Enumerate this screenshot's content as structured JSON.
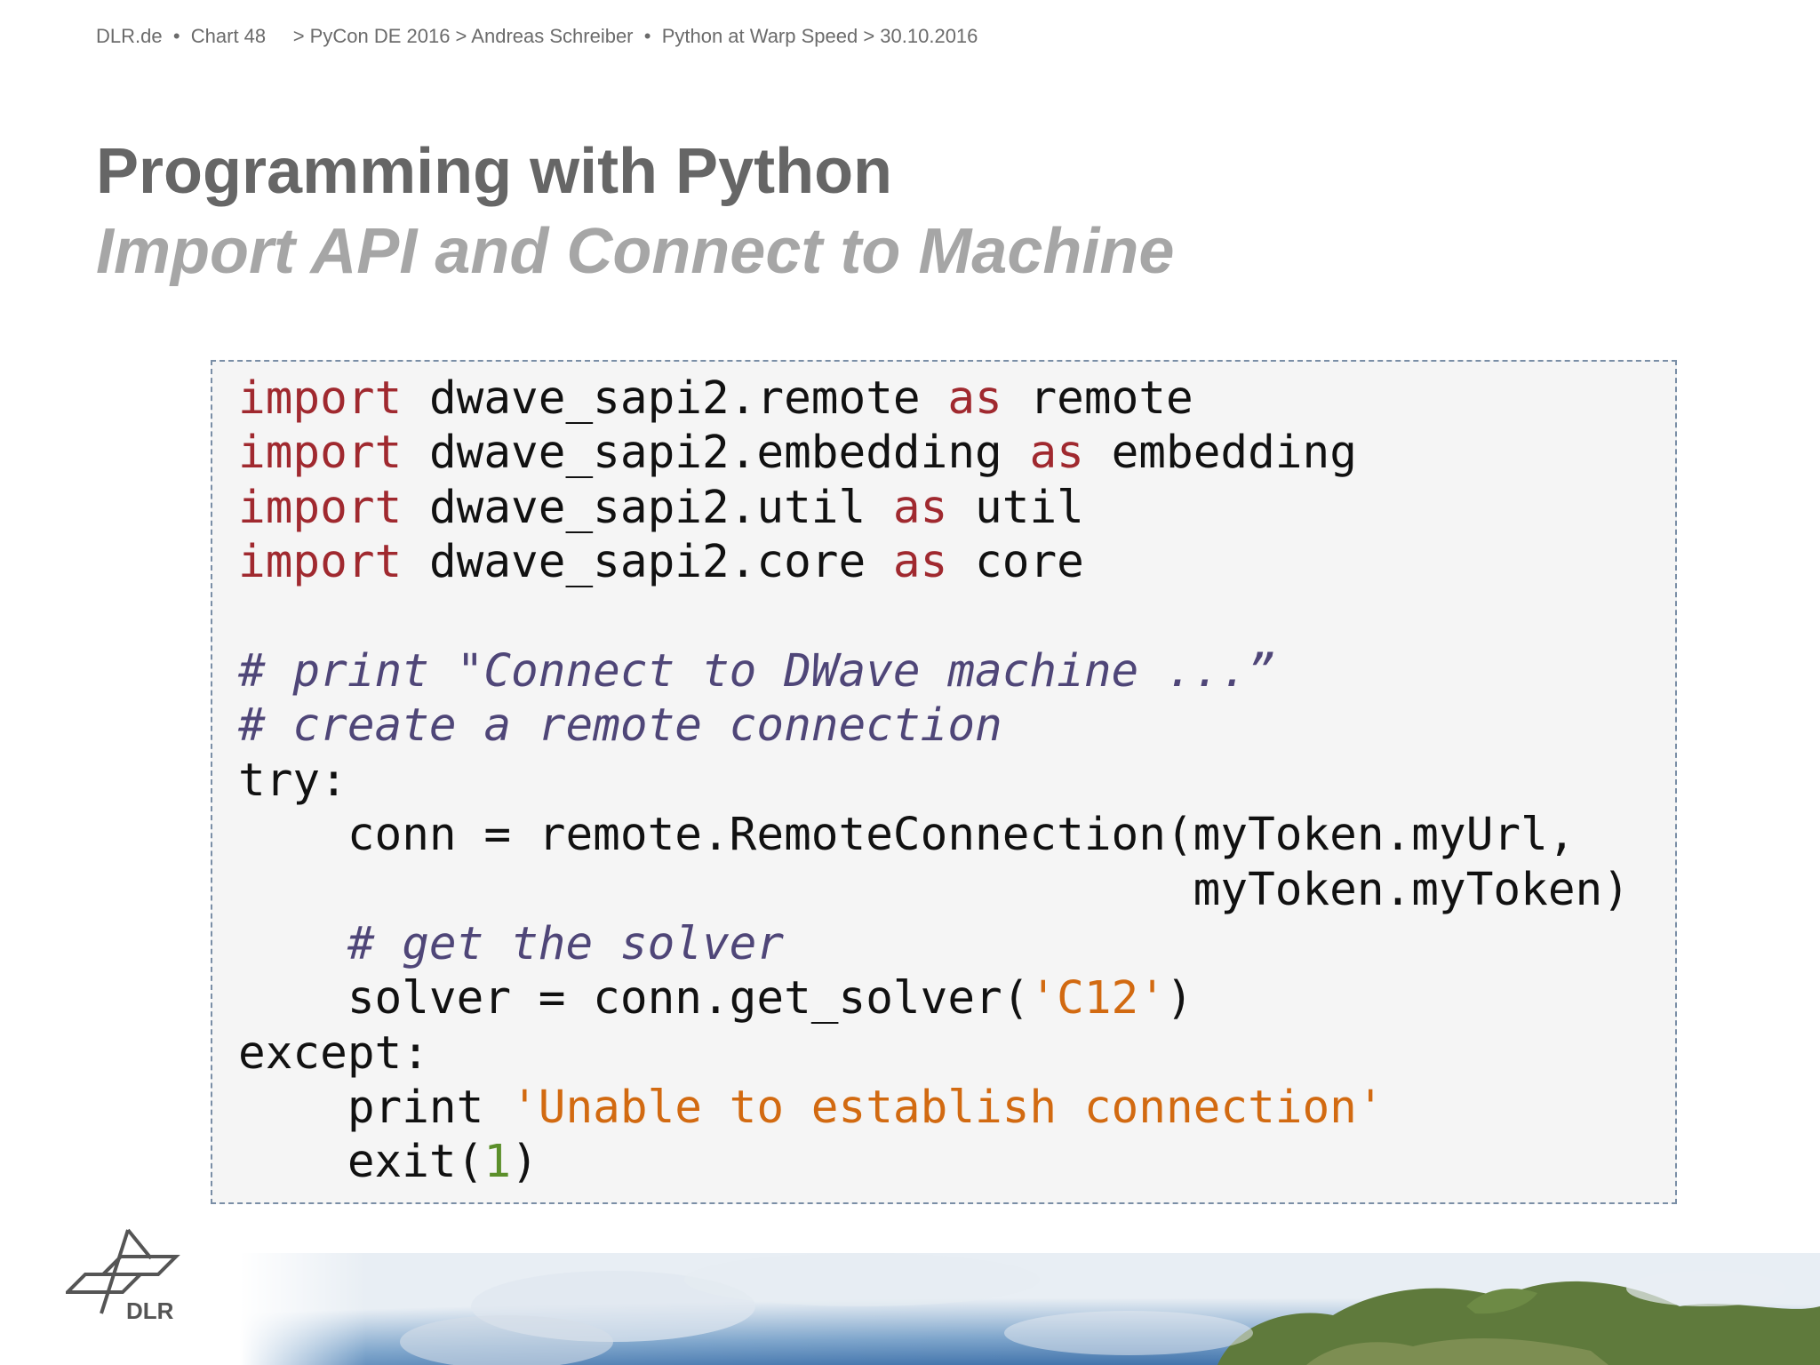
{
  "header": {
    "site": "DLR.de",
    "bullet1": "•",
    "chart": "Chart 48",
    "breadcrumb": "> PyCon DE 2016 > Andreas Schreiber",
    "bullet2": "•",
    "talk": "Python at Warp Speed > 30.10.2016"
  },
  "slide": {
    "title": "Programming with Python",
    "subtitle": "Import API and Connect to Machine"
  },
  "code": {
    "lines": [
      {
        "parts": [
          [
            "kw",
            "import"
          ],
          [
            "pl",
            " dwave_sapi2.remote "
          ],
          [
            "kw",
            "as"
          ],
          [
            "pl",
            " remote"
          ]
        ]
      },
      {
        "parts": [
          [
            "kw",
            "import"
          ],
          [
            "pl",
            " dwave_sapi2.embedding "
          ],
          [
            "kw",
            "as"
          ],
          [
            "pl",
            " embedding"
          ]
        ]
      },
      {
        "parts": [
          [
            "kw",
            "import"
          ],
          [
            "pl",
            " dwave_sapi2.util "
          ],
          [
            "kw",
            "as"
          ],
          [
            "pl",
            " util"
          ]
        ]
      },
      {
        "parts": [
          [
            "kw",
            "import"
          ],
          [
            "pl",
            " dwave_sapi2.core "
          ],
          [
            "kw",
            "as"
          ],
          [
            "pl",
            " core"
          ]
        ]
      },
      {
        "parts": []
      },
      {
        "parts": [
          [
            "cm",
            "# print \"Connect to DWave machine ...”"
          ]
        ]
      },
      {
        "parts": [
          [
            "cm",
            "# create a remote connection"
          ]
        ]
      },
      {
        "parts": [
          [
            "pl",
            "try:"
          ]
        ]
      },
      {
        "parts": [
          [
            "pl",
            "    conn = remote.RemoteConnection(myToken.myUrl,"
          ]
        ]
      },
      {
        "parts": [
          [
            "pl",
            "                                   myToken.myToken)"
          ]
        ]
      },
      {
        "parts": [
          [
            "cm",
            "    # get the solver"
          ]
        ]
      },
      {
        "parts": [
          [
            "pl",
            "    solver = conn.get_solver("
          ],
          [
            "st",
            "'C12'"
          ],
          [
            "pl",
            ")"
          ]
        ]
      },
      {
        "parts": [
          [
            "pl",
            "except:"
          ]
        ]
      },
      {
        "parts": [
          [
            "pl",
            "    print "
          ],
          [
            "st",
            "'Unable to establish connection'"
          ]
        ]
      },
      {
        "parts": [
          [
            "pl",
            "    exit("
          ],
          [
            "nm",
            "1"
          ],
          [
            "pl",
            ")"
          ]
        ]
      }
    ]
  },
  "logo": {
    "text": "DLR"
  }
}
